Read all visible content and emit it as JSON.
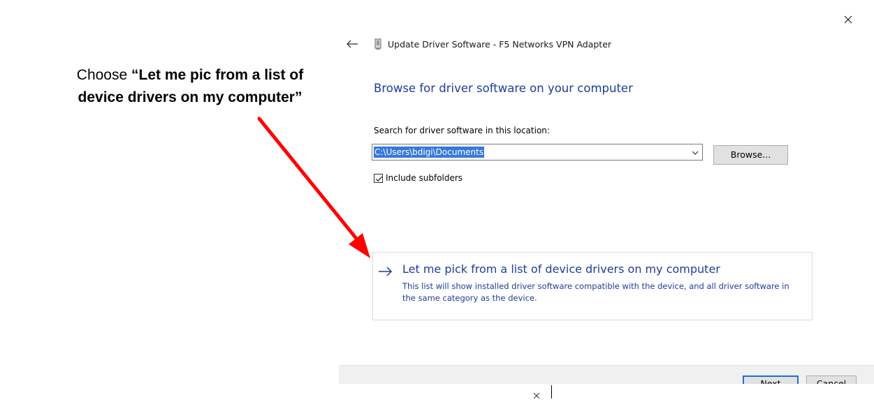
{
  "annotation": {
    "line1_prefix": "Choose ",
    "line1_bold": "“Let me pic from a list of",
    "line2_bold": "device drivers on my computer”"
  },
  "icons": {
    "close": "close-icon",
    "back": "back-arrow-icon",
    "device": "device-icon",
    "dropdown": "chevron-down-icon",
    "checkmark": "checkmark-icon",
    "pick_arrow": "right-arrow-icon"
  },
  "window": {
    "title": "Update Driver Software - F5 Networks VPN Adapter"
  },
  "page": {
    "heading": "Browse for driver software on your computer",
    "search_label": "Search for driver software in this location:",
    "path_value": "C:\\Users\\bdigi\\Documents",
    "browse_label": "Browse...",
    "include_subfolders_label": "Include subfolders",
    "include_subfolders_checked": true
  },
  "pick_option": {
    "title": "Let me pick from a list of device drivers on my computer",
    "description": "This list will show installed driver software compatible with the device, and all driver software in the same category as the device."
  },
  "footer": {
    "next_label": "Next",
    "cancel_label": "Cancel"
  },
  "colors": {
    "link_blue": "#1f3c9a",
    "selection_blue": "#3679d8",
    "annotation_arrow": "#ff0000",
    "default_button_border": "#1f6fd4"
  }
}
